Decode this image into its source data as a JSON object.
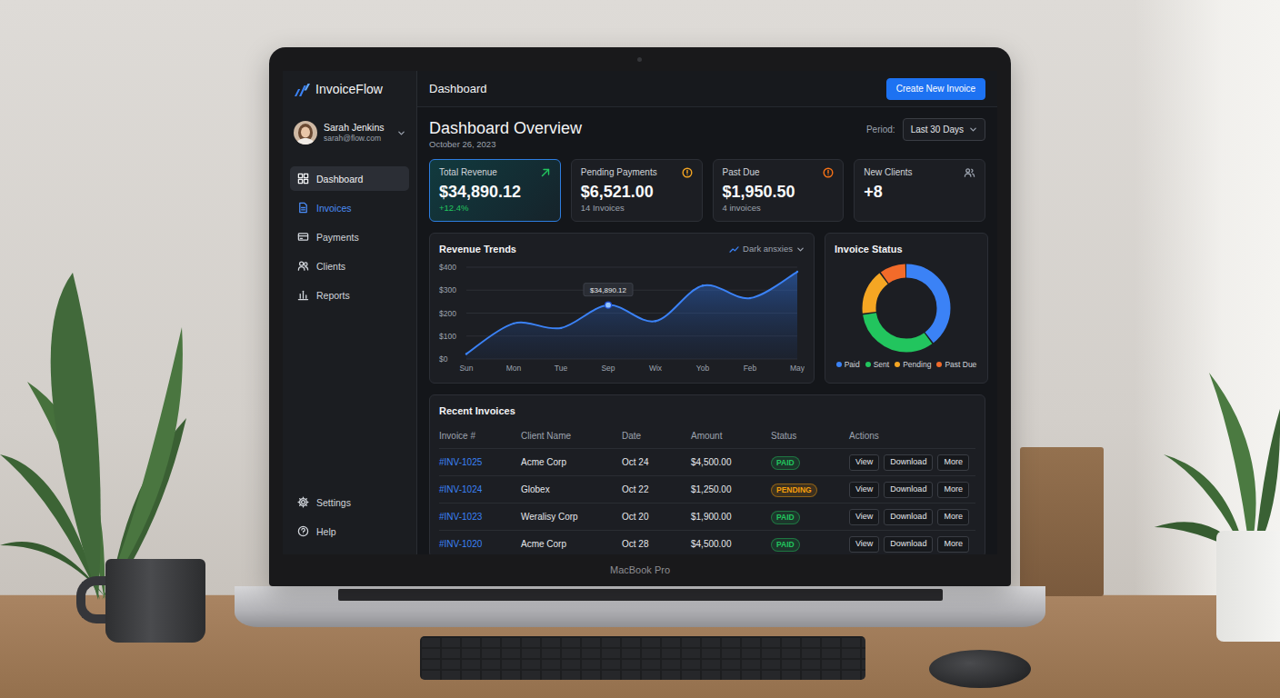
{
  "device": {
    "label": "MacBook Pro"
  },
  "sidebar": {
    "logo": "InvoiceFlow",
    "user": {
      "name": "Sarah Jenkins",
      "email": "sarah@flow.com"
    },
    "items": [
      {
        "label": "Dashboard",
        "selected": true,
        "hovered": false
      },
      {
        "label": "Invoices",
        "selected": false,
        "hovered": true
      },
      {
        "label": "Payments",
        "selected": false,
        "hovered": false
      },
      {
        "label": "Clients",
        "selected": false,
        "hovered": false
      },
      {
        "label": "Reports",
        "selected": false,
        "hovered": false
      }
    ],
    "footer_items": [
      {
        "label": "Settings"
      },
      {
        "label": "Help"
      }
    ]
  },
  "header": {
    "title": "Dashboard",
    "button": "Create New Invoice"
  },
  "overview": {
    "title": "Dashboard Overview",
    "date": "October 26, 2023",
    "period_label": "Period:",
    "period": "Last 30 Days"
  },
  "stats": [
    {
      "label": "Total Revenue",
      "value": "$34,890.12",
      "note": "+12.4%",
      "positive": true,
      "selected": true,
      "color": "#22c55e"
    },
    {
      "label": "Pending Payments",
      "value": "$6,521.00",
      "note": "14 Invoices",
      "positive": false,
      "selected": false,
      "color": "#f5a623"
    },
    {
      "label": "Past Due",
      "value": "$1,950.50",
      "note": "4 invoices",
      "positive": false,
      "selected": false,
      "color": "#f97316"
    },
    {
      "label": "New Clients",
      "value": "+8",
      "selected": false,
      "color": "#9ca3af"
    }
  ],
  "revenue_chart": {
    "title": "Revenue Trends",
    "menu": "Dark ansxies",
    "y_ticks": [
      "$400",
      "$300",
      "$200",
      "$100",
      "$0"
    ],
    "axis_max": 400,
    "x_labels": [
      "Sun",
      "Mon",
      "Tue",
      "Sep",
      "Wix",
      "Yob",
      "Feb",
      "May"
    ],
    "series": [
      {
        "values": [
          22,
          155,
          135,
          235,
          165,
          320,
          265,
          380
        ]
      }
    ],
    "tooltip": {
      "text": "$34,890.12",
      "index": 3
    }
  },
  "status_chart": {
    "title": "Invoice Status",
    "segments": [
      {
        "label": "Paid",
        "value": 40,
        "color": "#3b82f6"
      },
      {
        "label": "Sent",
        "value": 33,
        "color": "#22c55e"
      },
      {
        "label": "Pending",
        "value": 17,
        "color": "#f5a623"
      },
      {
        "label": "Past Due",
        "value": 10,
        "color": "#f26b2a"
      }
    ]
  },
  "table": {
    "title": "Recent Invoices",
    "columns": [
      "Invoice #",
      "Client Name",
      "Date",
      "Amount",
      "Status",
      "Actions"
    ],
    "rows": [
      {
        "cells": [
          "#INV-1025",
          "Acme Corp",
          "Oct 24",
          "$4,500.00"
        ],
        "status": "PAID",
        "color": "#22c55e",
        "actions": [
          "View",
          "Download",
          "More"
        ]
      },
      {
        "cells": [
          "#INV-1024",
          "Globex",
          "Oct 22",
          "$1,250.00"
        ],
        "status": "PENDING",
        "color": "#f59e0b",
        "actions": [
          "View",
          "Download",
          "More"
        ]
      },
      {
        "cells": [
          "#INV-1023",
          "Weralisy Corp",
          "Oct 20",
          "$1,900.00"
        ],
        "status": "PAID",
        "color": "#22c55e",
        "actions": [
          "View",
          "Download",
          "More"
        ]
      },
      {
        "cells": [
          "#INV-1020",
          "Acme Corp",
          "Oct 28",
          "$4,500.00"
        ],
        "status": "PAID",
        "color": "#22c55e",
        "actions": [
          "View",
          "Download",
          "More"
        ]
      }
    ]
  }
}
